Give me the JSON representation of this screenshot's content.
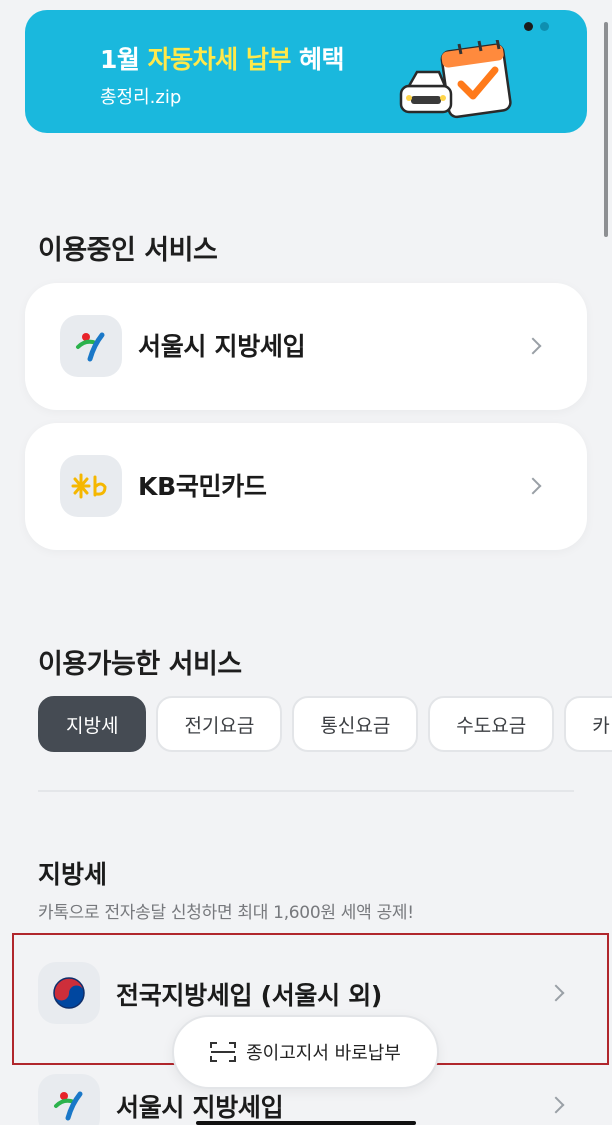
{
  "banner": {
    "title_prefix": "1월 ",
    "title_highlight": "자동차세 납부",
    "title_suffix": " 혜택",
    "subtitle": "총정리.zip",
    "colors": {
      "background": "#1ab8dd",
      "highlight": "#ffe94a"
    }
  },
  "in_use": {
    "title": "이용중인 서비스",
    "items": [
      {
        "label": "서울시 지방세입",
        "icon": "seoul-logo-icon"
      },
      {
        "label": "KB국민카드",
        "icon": "kb-logo-icon"
      }
    ]
  },
  "available": {
    "title": "이용가능한 서비스",
    "chips": [
      {
        "label": "지방세",
        "active": true
      },
      {
        "label": "전기요금",
        "active": false
      },
      {
        "label": "통신요금",
        "active": false
      },
      {
        "label": "수도요금",
        "active": false
      },
      {
        "label": "카",
        "active": false
      }
    ]
  },
  "local_tax": {
    "title": "지방세",
    "description": "카톡으로 전자송달 신청하면 최대 1,600원 세액 공제!",
    "items": [
      {
        "label": "전국지방세입 (서울시 외)",
        "icon": "taegeuk-icon"
      },
      {
        "label": "서울시 지방세입",
        "icon": "seoul-logo-icon"
      }
    ]
  },
  "floating_button": {
    "label": "종이고지서 바로납부",
    "icon": "scan-icon"
  }
}
